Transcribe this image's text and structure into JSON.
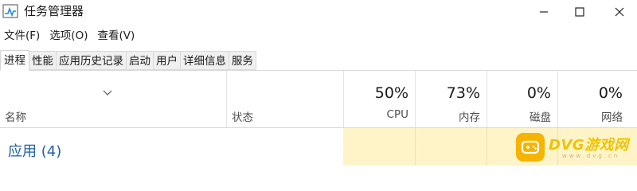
{
  "window": {
    "title": "任务管理器",
    "icon": "task-manager-icon",
    "controls": [
      "minimize-icon",
      "maximize-icon",
      "close-icon"
    ]
  },
  "menu": {
    "items": [
      "文件(F)",
      "选项(O)",
      "查看(V)"
    ]
  },
  "tabs": {
    "items": [
      "进程",
      "性能",
      "应用历史记录",
      "启动",
      "用户",
      "详细信息",
      "服务"
    ],
    "active": "进程"
  },
  "table": {
    "sort_icon": "chevron-down-icon",
    "columns": {
      "name": "名称",
      "status": "状态",
      "cpu": {
        "value": "50%",
        "label": "CPU"
      },
      "memory": {
        "value": "73%",
        "label": "内存"
      },
      "disk": {
        "value": "0%",
        "label": "磁盘"
      },
      "network": {
        "value": "0%",
        "label": "网络"
      }
    },
    "group": {
      "title": "应用 (4)"
    }
  },
  "watermark": {
    "text": "DVG游戏网",
    "subtext": "www.dvg.cn",
    "color": "#f2c200"
  },
  "colors": {
    "accent": "#1f5fa6",
    "highlight": "#fff4c8"
  }
}
